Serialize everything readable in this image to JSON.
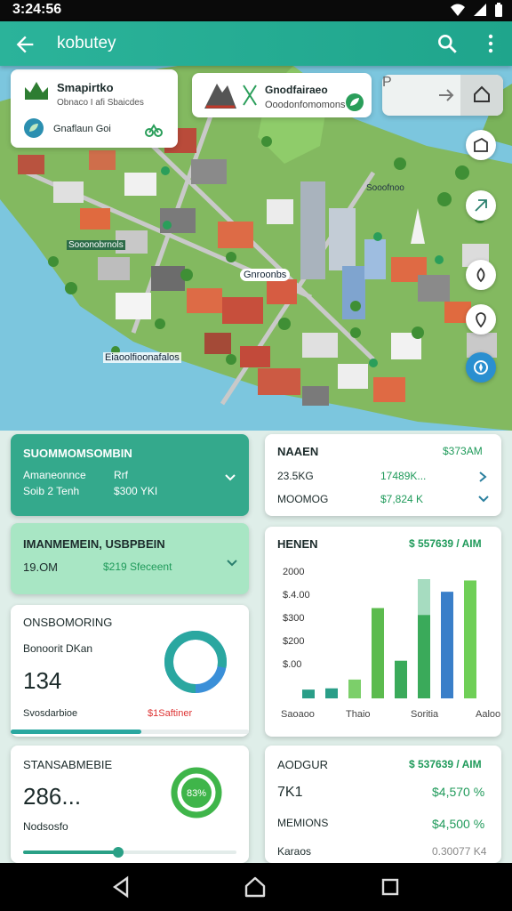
{
  "status": {
    "time": "3:24:56"
  },
  "appbar": {
    "title": "kobutey",
    "back_icon": "arrow-left-icon",
    "search_icon": "search-icon",
    "more_icon": "more-vert-icon"
  },
  "map": {
    "card1": {
      "title": "Smapirtko",
      "subtitle": "Obnaco I afi Sbaicdes",
      "row": "Gnaflaun Goi"
    },
    "card2": {
      "title": "Gnodfairaeo",
      "subtitle": "Ooodonfomomons"
    },
    "card3": {
      "label": "P"
    },
    "labels": {
      "district": "Sooonobrnols",
      "plaza": "Gnroonbs",
      "pier": "Eiaoolfioonafalos",
      "shore": "Sooofnoo"
    }
  },
  "panels": {
    "summary": {
      "title": "SUOMMOMSOMBIN",
      "r1a": "Amaneonnce",
      "r1b": "Rrf",
      "r2a": "Soib 2 Tenh",
      "r2b": "$300 YKI"
    },
    "stats": {
      "title": "NAAEN",
      "link": "$373AM",
      "r1a": "23.5KG",
      "r1b": "17489K...",
      "r2a": "MOOMOG",
      "r2b": "$7,824 K"
    },
    "maint": {
      "title": "IMANMEMEIN, USBPBEIN",
      "r1a": "19.OM",
      "r1b": "$219 Sfeceent"
    },
    "chart_panel": {
      "title": "HENEN",
      "badge": "$ 557639 / AIM"
    },
    "ops": {
      "title": "ONSBOMORING",
      "sub": "Bonoorit DKan",
      "value": "134",
      "footer_a": "Svosdarbioe",
      "footer_b": "$1Saftiner",
      "progress": 0.55
    },
    "standard": {
      "title": "STANSABMEBIE",
      "value": "286...",
      "sub": "Nodsosfo",
      "ring_label": "83%",
      "progress": 0.45
    },
    "agour": {
      "title": "AODGUR",
      "badge": "$ 537639 / AIM",
      "r1a": "7K1",
      "r1b": "$4,570 %",
      "r2a": "MEMIONS",
      "r2b": "$4,500 %",
      "r3a": "Karaos",
      "r3b": "0.30077 K4"
    }
  },
  "chart_data": {
    "type": "bar",
    "title": "",
    "ylabel": "",
    "yticks": [
      "2000",
      "$.4.00",
      "$300",
      "$200",
      "$.00"
    ],
    "categories": [
      "Saoaoo",
      "Thaio",
      "Soritia",
      "Aaloo"
    ],
    "series": [
      {
        "name": "",
        "values": [
          0.07,
          0.08,
          0.15,
          0.72,
          0.3,
          0.95,
          0.85,
          0.94
        ],
        "colors": [
          "#2a9e88",
          "#2a9e88",
          "#7ccf6a",
          "#5cbb4e",
          "#3aaa5a",
          "#3aaa5a",
          "#3a7fc9",
          "#6fcf57"
        ]
      }
    ],
    "stack_tops": [
      null,
      null,
      null,
      null,
      null,
      0.42,
      null,
      null
    ]
  },
  "donut": {
    "progress": 0.78,
    "colors": [
      "#2aa7a0",
      "#3a8fd8"
    ]
  }
}
